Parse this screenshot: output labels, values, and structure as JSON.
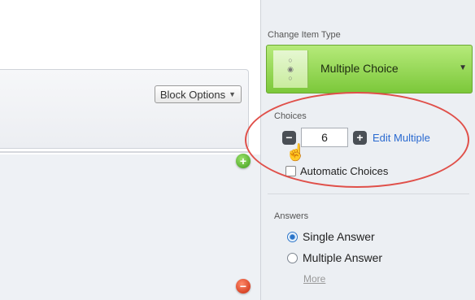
{
  "block": {
    "options_label": "Block Options"
  },
  "sidebar": {
    "change_item_type_label": "Change Item Type",
    "item_type_value": "Multiple Choice",
    "choices": {
      "label": "Choices",
      "count": "6",
      "edit_multiple_label": "Edit Multiple",
      "automatic_choices_label": "Automatic Choices",
      "automatic_choices_checked": false
    },
    "answers": {
      "label": "Answers",
      "options": [
        {
          "label": "Single Answer",
          "checked": true
        },
        {
          "label": "Multiple Answer",
          "checked": false
        }
      ],
      "more_label": "More"
    }
  },
  "colors": {
    "item_type_green": "#7cc83a",
    "link_blue": "#2a6ad0",
    "highlight_red": "#e0504a",
    "add_green": "#3e9a1c",
    "remove_red": "#c8280c"
  },
  "icons": {
    "add": "plus-circle-icon",
    "remove": "minus-circle-icon",
    "item_type": "multiple-choice-radio-icon",
    "cursor": "hand-pointer-icon"
  }
}
